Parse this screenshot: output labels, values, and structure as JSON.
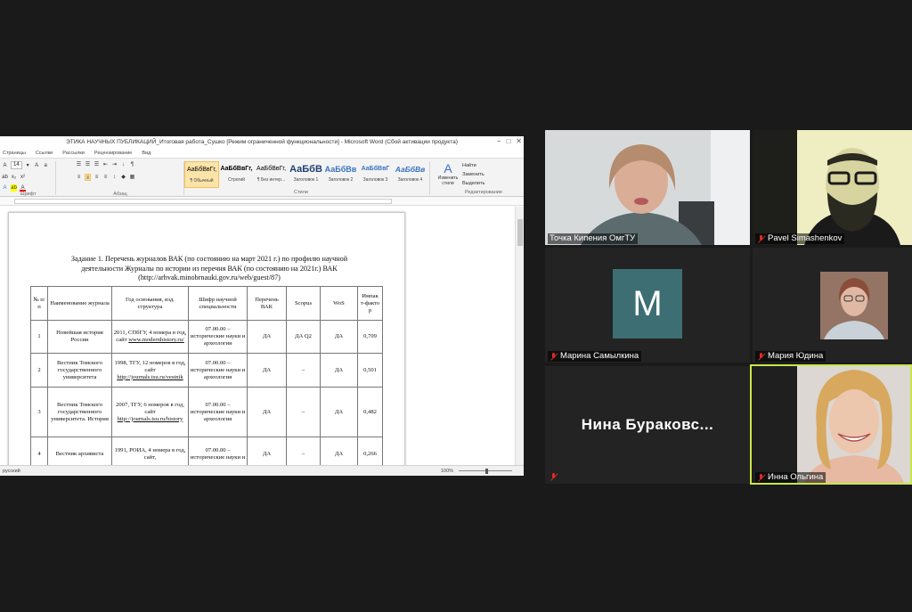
{
  "word": {
    "title": "ЭТИКА НАУЧНЫХ ПУБЛИКАЦИЙ_Итоговая работа_Сушко [Режим ограниченной функциональности] - Microsoft Word (Сбой активации продукта)",
    "window_controls": [
      "−",
      "□",
      "✕"
    ],
    "tabs": [
      "Страницы",
      "Ссылки",
      "Рассылки",
      "Рецензирование",
      "Вид"
    ],
    "font_size": "14",
    "group_labels": {
      "font": "Шрифт",
      "paragraph": "Абзац",
      "styles": "Стили",
      "editing": "Редактирование"
    },
    "styles": [
      {
        "preview": "АаБбВвГг,",
        "name": "¶ Обычный",
        "active": true
      },
      {
        "preview": "АаБбВвГг,",
        "name": "Строгий",
        "active": false
      },
      {
        "preview": "АаБбВвГг,",
        "name": "¶ Без интер...",
        "active": false
      },
      {
        "preview": "АаБбВ",
        "name": "Заголовок 1",
        "active": false
      },
      {
        "preview": "АаБбВв",
        "name": "Заголовок 2",
        "active": false
      },
      {
        "preview": "АаБбВвГ",
        "name": "Заголовок 3",
        "active": false
      },
      {
        "preview": "АаБбВв",
        "name": "Заголовок 4",
        "active": false
      }
    ],
    "change_styles": "Изменить стили",
    "editing": [
      "Найти",
      "Заменить",
      "Выделить"
    ],
    "status": {
      "language": "русский",
      "zoom": "100%"
    },
    "document": {
      "heading_line1": "Задание 1. Перечень журналов ВАК (по состоянию на март 2021 г.) по профилю научной",
      "heading_line2": "деятельности Журналы по истории из перечня ВАК (по состоянию на 2021г.) ВАК",
      "heading_line3": "(http://arhvak.minobrnauki.gov.ru/web/guest/87)",
      "columns": [
        "№ п/ п",
        "Наименование журнала",
        "Год основания, изд. структура",
        "Шифр научной специальности",
        "Перечень ВАК",
        "Scopus",
        "WoS",
        "Импак т-факто р"
      ],
      "rows": [
        {
          "n": "1",
          "name": "Новейшая история России",
          "year": "2011, СПбГУ, 4 номера в год, сайт",
          "link": "www.modernhistory.ru/",
          "code": "07.00.00 – исторические науки и археология",
          "vak": "ДА",
          "scopus": "ДА Q2",
          "wos": "ДА",
          "impact": "0,709"
        },
        {
          "n": "2",
          "name": "Вестник Томского государственного университета",
          "year": "1998, ТГУ, 12 номеров в год, сайт",
          "link": "http://journals.tsu.ru/vestnik",
          "code": "07.00.00 – исторические науки и археология",
          "vak": "ДА",
          "scopus": "–",
          "wos": "ДА",
          "impact": "0,501"
        },
        {
          "n": "3",
          "name": "Вестник Томского государственного университета. История",
          "year": "2007, ТГУ, 6 номеров в год, сайт",
          "link": "http://journals.tsu.ru/history",
          "code": "07.00.00 – исторические науки и археология",
          "vak": "ДА",
          "scopus": "–",
          "wos": "ДА",
          "impact": "0,482"
        },
        {
          "n": "4",
          "name": "Вестник архивиста",
          "year": "1991, РОИА, 4 номера в год, сайт,",
          "link": "",
          "code": "07.00.00 – исторические науки и",
          "vak": "ДА",
          "scopus": "–",
          "wos": "ДА",
          "impact": "0,266"
        }
      ]
    }
  },
  "participants": [
    {
      "name": "Точка Кипения ОмгТУ",
      "muted": false,
      "video": true
    },
    {
      "name": "Pavel Simashenkov",
      "muted": true,
      "video": true
    },
    {
      "name": "Марина Самылкина",
      "muted": true,
      "video": false,
      "initial": "M",
      "avatar_color": "#3d6e73"
    },
    {
      "name": "Мария Юдина",
      "muted": true,
      "video": true
    },
    {
      "name": "Нина Бураковс...",
      "muted": true,
      "video": false
    },
    {
      "name": "Инна Ольгина",
      "muted": true,
      "video": true,
      "active_speaker": true
    }
  ],
  "colors": {
    "active_speaker_border": "#c7e74a",
    "muted_icon": "#e02828"
  }
}
